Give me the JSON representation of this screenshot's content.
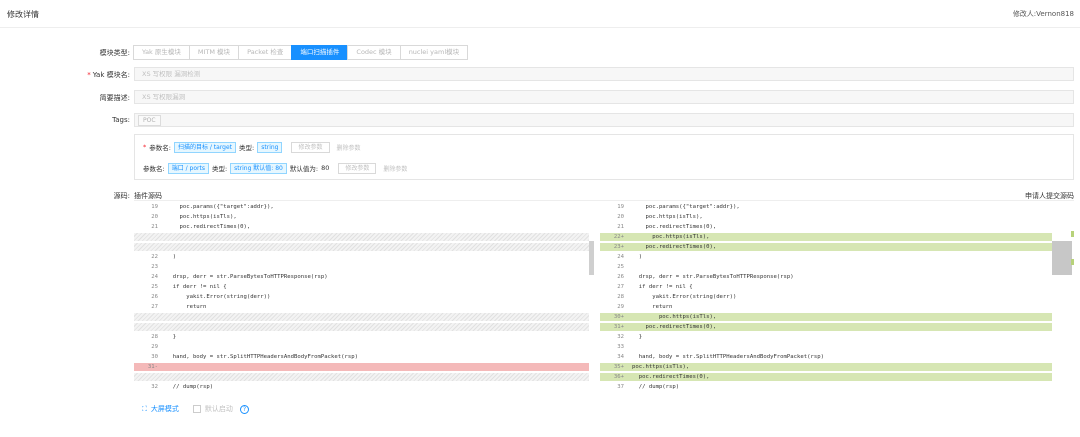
{
  "header": {
    "title": "修改详情",
    "modifier": "修改人:Vernon818"
  },
  "form": {
    "module_type_label": "模块类型:",
    "module_types": [
      "Yak 原生模块",
      "MITM 模块",
      "Packet 检查",
      "端口扫描插件",
      "Codec 模块",
      "nuclei yaml模块"
    ],
    "active_type": "端口扫描插件",
    "name_label": "Yak 模块名:",
    "name_value": "XS 写权限 漏洞检测",
    "desc_label": "简要描述:",
    "desc_value": "XS 写权限漏洞",
    "tags_label": "Tags:",
    "tags": [
      "POC"
    ]
  },
  "params": [
    {
      "required": true,
      "name_label": "参数名:",
      "name": "扫描的目标 / target",
      "type_label": "类型:",
      "type": "string",
      "default_label": "",
      "default": "",
      "edit": "修改参数",
      "delete": "删除参数"
    },
    {
      "required": false,
      "name_label": "参数名:",
      "name": "端口 / ports",
      "type_label": "类型:",
      "type": "string 默认值: 80",
      "default_label": "默认值为:",
      "default": "80",
      "edit": "修改参数",
      "delete": "删除参数"
    }
  ],
  "source": {
    "label": "源码:",
    "left_title": "插件源码",
    "right_title": "申请人提交源码",
    "left_lines": [
      {
        "n": "19",
        "t": "    poc.params({\"target\":addr}),",
        "k": ""
      },
      {
        "n": "20",
        "t": "    poc.https(isTls),",
        "k": ""
      },
      {
        "n": "21",
        "t": "    poc.redirectTimes(0),",
        "k": ""
      },
      {
        "n": "",
        "t": "",
        "k": "hatch"
      },
      {
        "n": "",
        "t": "",
        "k": "hatch"
      },
      {
        "n": "22",
        "t": "  )",
        "k": ""
      },
      {
        "n": "23",
        "t": "",
        "k": ""
      },
      {
        "n": "24",
        "t": "  drsp, derr = str.ParseBytesToHTTPResponse(rsp)",
        "k": ""
      },
      {
        "n": "25",
        "t": "  if derr != nil {",
        "k": ""
      },
      {
        "n": "26",
        "t": "      yakit.Error(string(derr))",
        "k": ""
      },
      {
        "n": "27",
        "t": "      return",
        "k": ""
      },
      {
        "n": "",
        "t": "",
        "k": "hatch"
      },
      {
        "n": "",
        "t": "",
        "k": "hatch"
      },
      {
        "n": "28",
        "t": "  }",
        "k": ""
      },
      {
        "n": "29",
        "t": "",
        "k": ""
      },
      {
        "n": "30",
        "t": "  hand, body = str.SplitHTTPHeadersAndBodyFromPacket(rsp)",
        "k": ""
      },
      {
        "n": "31-",
        "t": "",
        "k": "del"
      },
      {
        "n": "",
        "t": "",
        "k": "hatch"
      },
      {
        "n": "32",
        "t": "  // dump(rsp)",
        "k": ""
      }
    ],
    "right_lines": [
      {
        "n": "19",
        "t": "    poc.params({\"target\":addr}),",
        "k": ""
      },
      {
        "n": "20",
        "t": "    poc.https(isTls),",
        "k": ""
      },
      {
        "n": "21",
        "t": "    poc.redirectTimes(0),",
        "k": ""
      },
      {
        "n": "22+",
        "t": "      poc.https(isTls),",
        "k": "add"
      },
      {
        "n": "23+",
        "t": "    poc.redirectTimes(0),",
        "k": "add"
      },
      {
        "n": "24",
        "t": "  )",
        "k": ""
      },
      {
        "n": "25",
        "t": "",
        "k": ""
      },
      {
        "n": "26",
        "t": "  drsp, derr = str.ParseBytesToHTTPResponse(rsp)",
        "k": ""
      },
      {
        "n": "27",
        "t": "  if derr != nil {",
        "k": ""
      },
      {
        "n": "28",
        "t": "      yakit.Error(string(derr))",
        "k": ""
      },
      {
        "n": "29",
        "t": "      return",
        "k": ""
      },
      {
        "n": "30+",
        "t": "        poc.https(isTls),",
        "k": "add"
      },
      {
        "n": "31+",
        "t": "    poc.redirectTimes(0),",
        "k": "add"
      },
      {
        "n": "32",
        "t": "  }",
        "k": ""
      },
      {
        "n": "33",
        "t": "",
        "k": ""
      },
      {
        "n": "34",
        "t": "  hand, body = str.SplitHTTPHeadersAndBodyFromPacket(rsp)",
        "k": ""
      },
      {
        "n": "35+",
        "t": "poc.https(isTls),",
        "k": "add"
      },
      {
        "n": "36+",
        "t": "  poc.redirectTimes(0),",
        "k": "add"
      },
      {
        "n": "37",
        "t": "  // dump(rsp)",
        "k": ""
      }
    ]
  },
  "footer": {
    "fullscreen_icon": "expand-icon",
    "fullscreen": "大屏模式",
    "default_enable": "默认启动",
    "help_icon": "question-circle-icon",
    "help_glyph": "?"
  }
}
